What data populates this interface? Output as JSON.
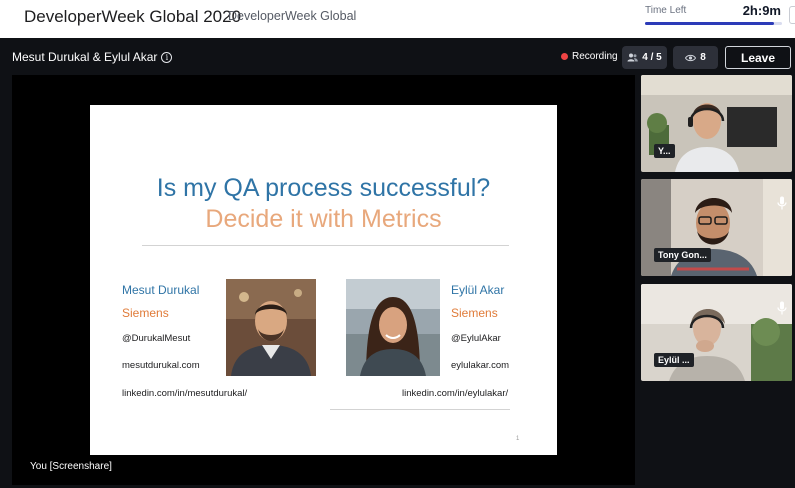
{
  "header": {
    "app_title": "DeveloperWeek Global 2020",
    "app_subtitle": "DeveloperWeek Global",
    "time_left_label": "Time Left",
    "time_left_value": "2h:9m",
    "time_progress": 0.94
  },
  "session": {
    "title": "Mesut Durukal & Eylul Akar",
    "info_icon": "info-icon",
    "recording_label": "Recording",
    "speakers_count": "4 / 5",
    "viewers_count": "8",
    "leave_label": "Leave"
  },
  "stage": {
    "label": "You [Screenshare]",
    "slide": {
      "title_line1": "Is my QA process successful?",
      "title_line2": "Decide it with Metrics",
      "speaker1": {
        "name": "Mesut Durukal",
        "org": "Siemens",
        "handle": "@DurukalMesut",
        "site": "mesutdurukal.com",
        "linkedin": "linkedin.com/in/mesutdurukal/"
      },
      "speaker2": {
        "name": "Eylül Akar",
        "org": "Siemens",
        "handle": "@EylulAkar",
        "site": "eylulakar.com",
        "linkedin": "linkedin.com/in/eylulakar/"
      },
      "page_number": "1"
    }
  },
  "participants": [
    {
      "name": "Y...",
      "mic_icon": ""
    },
    {
      "name": "Tony Gon...",
      "mic_icon": "microphone-icon"
    },
    {
      "name": "Eylül ...",
      "mic_icon": "microphone-icon"
    }
  ],
  "colors": {
    "accent": "#2c3bb8",
    "recording": "#ef4444",
    "slide_blue": "#2f74a6",
    "slide_peach": "#e8a87c",
    "slide_orange": "#e07b39"
  }
}
